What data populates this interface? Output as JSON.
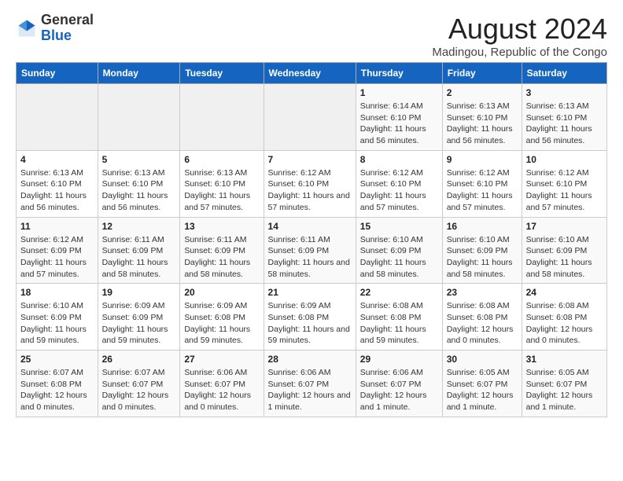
{
  "header": {
    "logo_general": "General",
    "logo_blue": "Blue",
    "main_title": "August 2024",
    "sub_title": "Madingou, Republic of the Congo"
  },
  "days_of_week": [
    "Sunday",
    "Monday",
    "Tuesday",
    "Wednesday",
    "Thursday",
    "Friday",
    "Saturday"
  ],
  "weeks": [
    [
      {
        "day": "",
        "empty": true
      },
      {
        "day": "",
        "empty": true
      },
      {
        "day": "",
        "empty": true
      },
      {
        "day": "",
        "empty": true
      },
      {
        "day": "1",
        "sunrise": "Sunrise: 6:14 AM",
        "sunset": "Sunset: 6:10 PM",
        "daylight": "Daylight: 11 hours and 56 minutes."
      },
      {
        "day": "2",
        "sunrise": "Sunrise: 6:13 AM",
        "sunset": "Sunset: 6:10 PM",
        "daylight": "Daylight: 11 hours and 56 minutes."
      },
      {
        "day": "3",
        "sunrise": "Sunrise: 6:13 AM",
        "sunset": "Sunset: 6:10 PM",
        "daylight": "Daylight: 11 hours and 56 minutes."
      }
    ],
    [
      {
        "day": "4",
        "sunrise": "Sunrise: 6:13 AM",
        "sunset": "Sunset: 6:10 PM",
        "daylight": "Daylight: 11 hours and 56 minutes."
      },
      {
        "day": "5",
        "sunrise": "Sunrise: 6:13 AM",
        "sunset": "Sunset: 6:10 PM",
        "daylight": "Daylight: 11 hours and 56 minutes."
      },
      {
        "day": "6",
        "sunrise": "Sunrise: 6:13 AM",
        "sunset": "Sunset: 6:10 PM",
        "daylight": "Daylight: 11 hours and 57 minutes."
      },
      {
        "day": "7",
        "sunrise": "Sunrise: 6:12 AM",
        "sunset": "Sunset: 6:10 PM",
        "daylight": "Daylight: 11 hours and 57 minutes."
      },
      {
        "day": "8",
        "sunrise": "Sunrise: 6:12 AM",
        "sunset": "Sunset: 6:10 PM",
        "daylight": "Daylight: 11 hours and 57 minutes."
      },
      {
        "day": "9",
        "sunrise": "Sunrise: 6:12 AM",
        "sunset": "Sunset: 6:10 PM",
        "daylight": "Daylight: 11 hours and 57 minutes."
      },
      {
        "day": "10",
        "sunrise": "Sunrise: 6:12 AM",
        "sunset": "Sunset: 6:10 PM",
        "daylight": "Daylight: 11 hours and 57 minutes."
      }
    ],
    [
      {
        "day": "11",
        "sunrise": "Sunrise: 6:12 AM",
        "sunset": "Sunset: 6:09 PM",
        "daylight": "Daylight: 11 hours and 57 minutes."
      },
      {
        "day": "12",
        "sunrise": "Sunrise: 6:11 AM",
        "sunset": "Sunset: 6:09 PM",
        "daylight": "Daylight: 11 hours and 58 minutes."
      },
      {
        "day": "13",
        "sunrise": "Sunrise: 6:11 AM",
        "sunset": "Sunset: 6:09 PM",
        "daylight": "Daylight: 11 hours and 58 minutes."
      },
      {
        "day": "14",
        "sunrise": "Sunrise: 6:11 AM",
        "sunset": "Sunset: 6:09 PM",
        "daylight": "Daylight: 11 hours and 58 minutes."
      },
      {
        "day": "15",
        "sunrise": "Sunrise: 6:10 AM",
        "sunset": "Sunset: 6:09 PM",
        "daylight": "Daylight: 11 hours and 58 minutes."
      },
      {
        "day": "16",
        "sunrise": "Sunrise: 6:10 AM",
        "sunset": "Sunset: 6:09 PM",
        "daylight": "Daylight: 11 hours and 58 minutes."
      },
      {
        "day": "17",
        "sunrise": "Sunrise: 6:10 AM",
        "sunset": "Sunset: 6:09 PM",
        "daylight": "Daylight: 11 hours and 58 minutes."
      }
    ],
    [
      {
        "day": "18",
        "sunrise": "Sunrise: 6:10 AM",
        "sunset": "Sunset: 6:09 PM",
        "daylight": "Daylight: 11 hours and 59 minutes."
      },
      {
        "day": "19",
        "sunrise": "Sunrise: 6:09 AM",
        "sunset": "Sunset: 6:09 PM",
        "daylight": "Daylight: 11 hours and 59 minutes."
      },
      {
        "day": "20",
        "sunrise": "Sunrise: 6:09 AM",
        "sunset": "Sunset: 6:08 PM",
        "daylight": "Daylight: 11 hours and 59 minutes."
      },
      {
        "day": "21",
        "sunrise": "Sunrise: 6:09 AM",
        "sunset": "Sunset: 6:08 PM",
        "daylight": "Daylight: 11 hours and 59 minutes."
      },
      {
        "day": "22",
        "sunrise": "Sunrise: 6:08 AM",
        "sunset": "Sunset: 6:08 PM",
        "daylight": "Daylight: 11 hours and 59 minutes."
      },
      {
        "day": "23",
        "sunrise": "Sunrise: 6:08 AM",
        "sunset": "Sunset: 6:08 PM",
        "daylight": "Daylight: 12 hours and 0 minutes."
      },
      {
        "day": "24",
        "sunrise": "Sunrise: 6:08 AM",
        "sunset": "Sunset: 6:08 PM",
        "daylight": "Daylight: 12 hours and 0 minutes."
      }
    ],
    [
      {
        "day": "25",
        "sunrise": "Sunrise: 6:07 AM",
        "sunset": "Sunset: 6:08 PM",
        "daylight": "Daylight: 12 hours and 0 minutes."
      },
      {
        "day": "26",
        "sunrise": "Sunrise: 6:07 AM",
        "sunset": "Sunset: 6:07 PM",
        "daylight": "Daylight: 12 hours and 0 minutes."
      },
      {
        "day": "27",
        "sunrise": "Sunrise: 6:06 AM",
        "sunset": "Sunset: 6:07 PM",
        "daylight": "Daylight: 12 hours and 0 minutes."
      },
      {
        "day": "28",
        "sunrise": "Sunrise: 6:06 AM",
        "sunset": "Sunset: 6:07 PM",
        "daylight": "Daylight: 12 hours and 1 minute."
      },
      {
        "day": "29",
        "sunrise": "Sunrise: 6:06 AM",
        "sunset": "Sunset: 6:07 PM",
        "daylight": "Daylight: 12 hours and 1 minute."
      },
      {
        "day": "30",
        "sunrise": "Sunrise: 6:05 AM",
        "sunset": "Sunset: 6:07 PM",
        "daylight": "Daylight: 12 hours and 1 minute."
      },
      {
        "day": "31",
        "sunrise": "Sunrise: 6:05 AM",
        "sunset": "Sunset: 6:07 PM",
        "daylight": "Daylight: 12 hours and 1 minute."
      }
    ]
  ]
}
